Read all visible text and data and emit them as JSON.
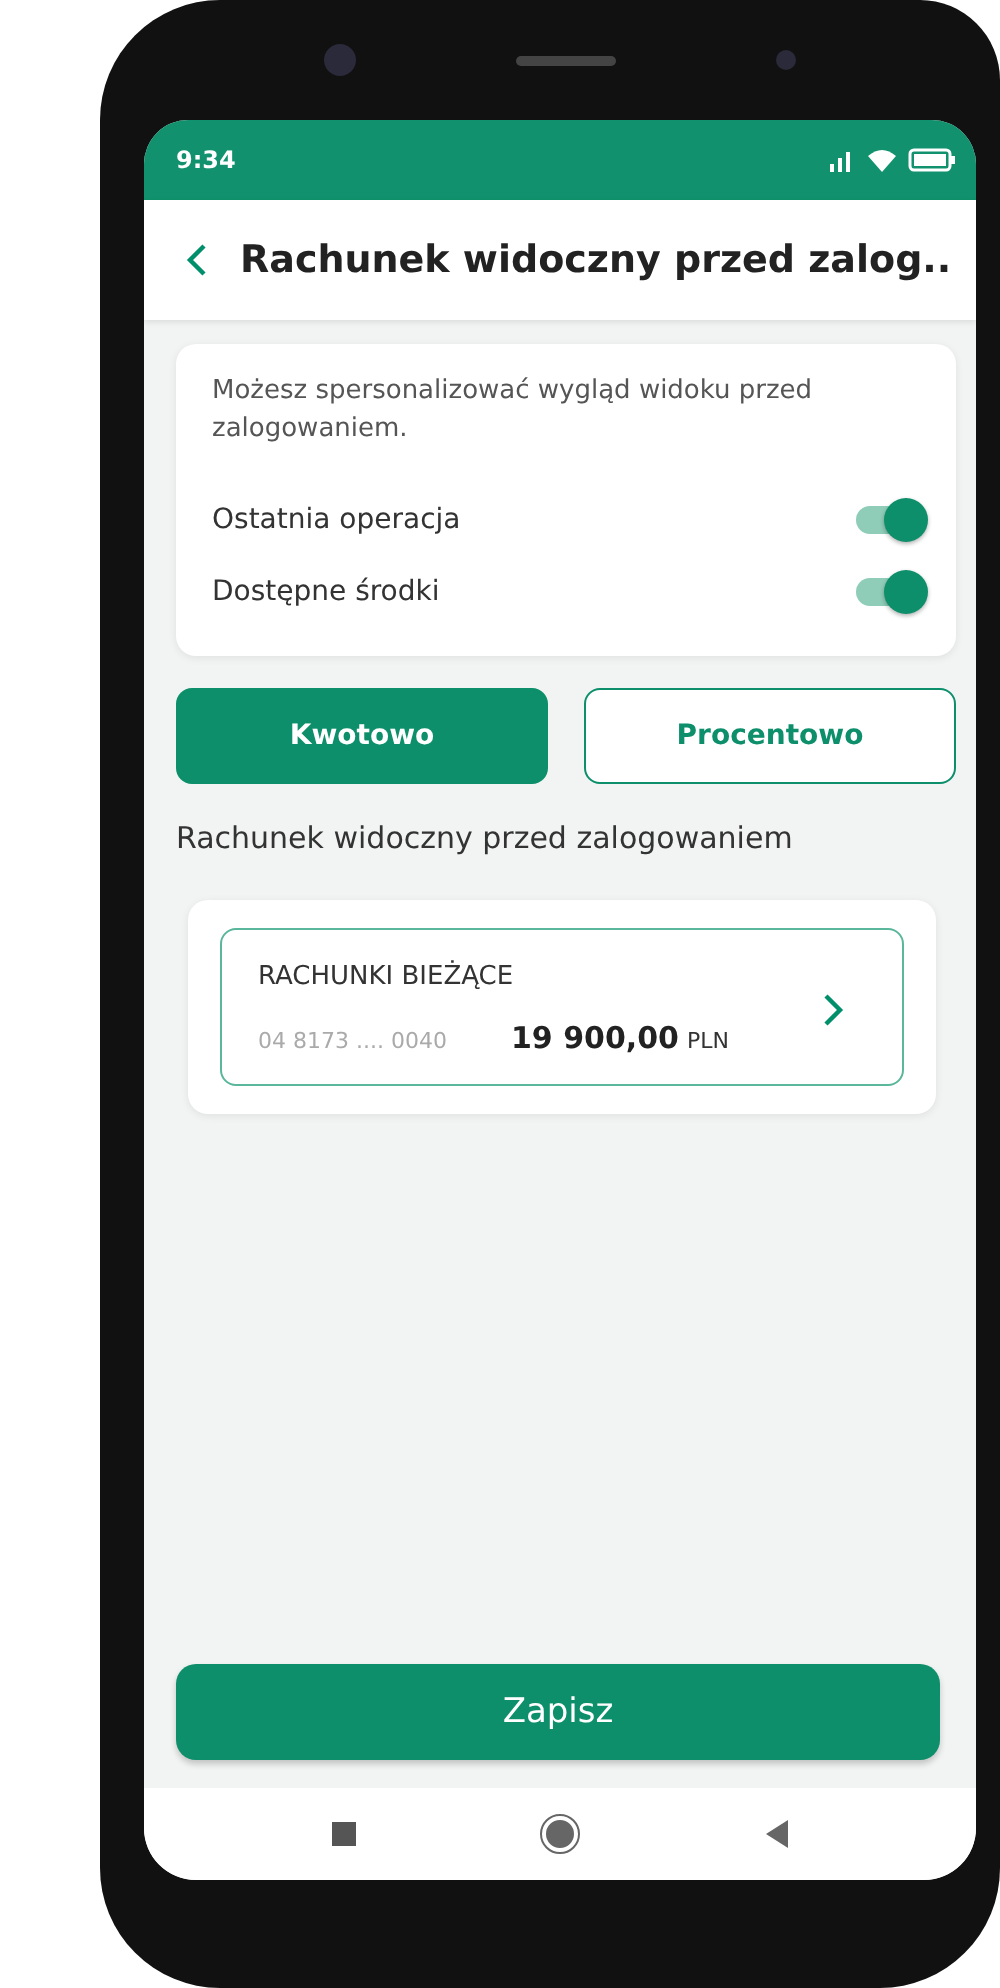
{
  "status_bar": {
    "time": "9:34"
  },
  "header": {
    "title": "Rachunek widoczny przed zalog.."
  },
  "settings_card": {
    "description": "Możesz spersonalizować wygląd widoku przed zalogowaniem.",
    "toggles": [
      {
        "label": "Ostatnia operacja",
        "on": true
      },
      {
        "label": "Dostępne środki",
        "on": true
      }
    ]
  },
  "mode_buttons": [
    {
      "label": "Kwotowo",
      "selected": true
    },
    {
      "label": "Procentowo",
      "selected": false
    }
  ],
  "section_title": "Rachunek widoczny przed zalogowaniem",
  "account": {
    "name": "RACHUNKI BIEŻĄCE",
    "number": "04 8173 .... 0040",
    "amount": "19 900,00",
    "currency": "PLN"
  },
  "save_button": "Zapisz"
}
